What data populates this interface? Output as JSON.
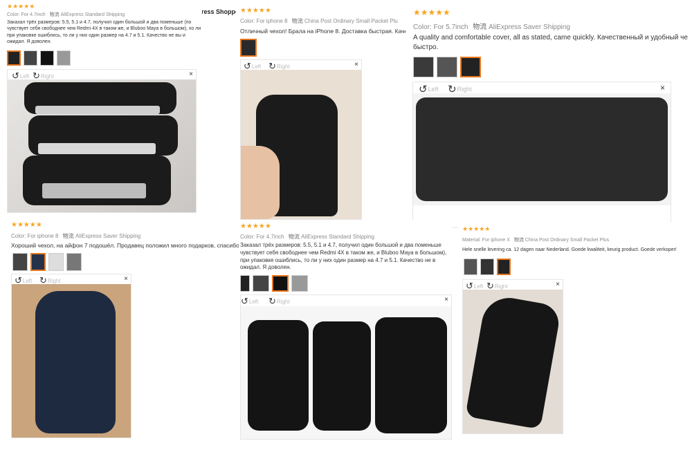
{
  "store": {
    "name": "ress Shopper"
  },
  "ui": {
    "left": "Left",
    "right": "Right",
    "close": "×",
    "stars": "★★★★★"
  },
  "reviews": [
    {
      "color_label": "Color:",
      "color": "For 4.7inch",
      "ship_label": "物流",
      "ship": "AliExpress Standard Shipping",
      "text": "Заказал трёх размеров: 5.5, 5.1 и 4.7, получил один большой и два поменьше (по чувствует себя свободнее чем Redmi 4X в таком же, и Bluboo Maya в большом), хо ли при упаковке ошиблись, то ли у них один размер на 4.7 и 5.1. Качество не вы и ожидал. Я доволен."
    },
    {
      "color_label": "Color:",
      "color": "For iphone 8",
      "ship_label": "物流",
      "ship": "China Post Ordinary Small Packet Plu",
      "text": "Отличный чехол! Брала на iPhone 8. Доставка быстрая. Каче"
    },
    {
      "color_label": "Color:",
      "color": "For 5.7inch",
      "ship_label": "物流",
      "ship": "AliExpress Saver Shipping",
      "text": "A quality and comfortable cover, all as stated, came quickly. Качественный и удобный че быстро."
    },
    {
      "color_label": "Color:",
      "color": "For iphone 8",
      "ship_label": "物流",
      "ship": "AliExpress Saver Shipping",
      "text": "Хороший чехол, на айфон 7 подошёл. Продавец положил много подарков, спасибо !"
    },
    {
      "color_label": "Color:",
      "color": "For 4.7inch",
      "ship_label": "物流",
      "ship": "AliExpress Standard Shipping",
      "text": "Заказал трёх размеров: 5.5, 5.1 и 4.7, получил один большой и два поменьше чувствует себя свободнее чем Redmi 4X в таком же, и Bluboo Maya в большом), при упаковке ошиблись, то ли у них один размер на 4.7 и 5.1. Качество не в ожидал. Я доволен."
    },
    {
      "color_label": "Material:",
      "color": "For iphone X",
      "ship_label": "物流",
      "ship": "China Post Ordinary Small Packet Plus",
      "text": "Hele snelle levering ca. 12 dagen naar Nederland. Goede kwaliteit, keurig product. Goede verkoper!"
    }
  ]
}
